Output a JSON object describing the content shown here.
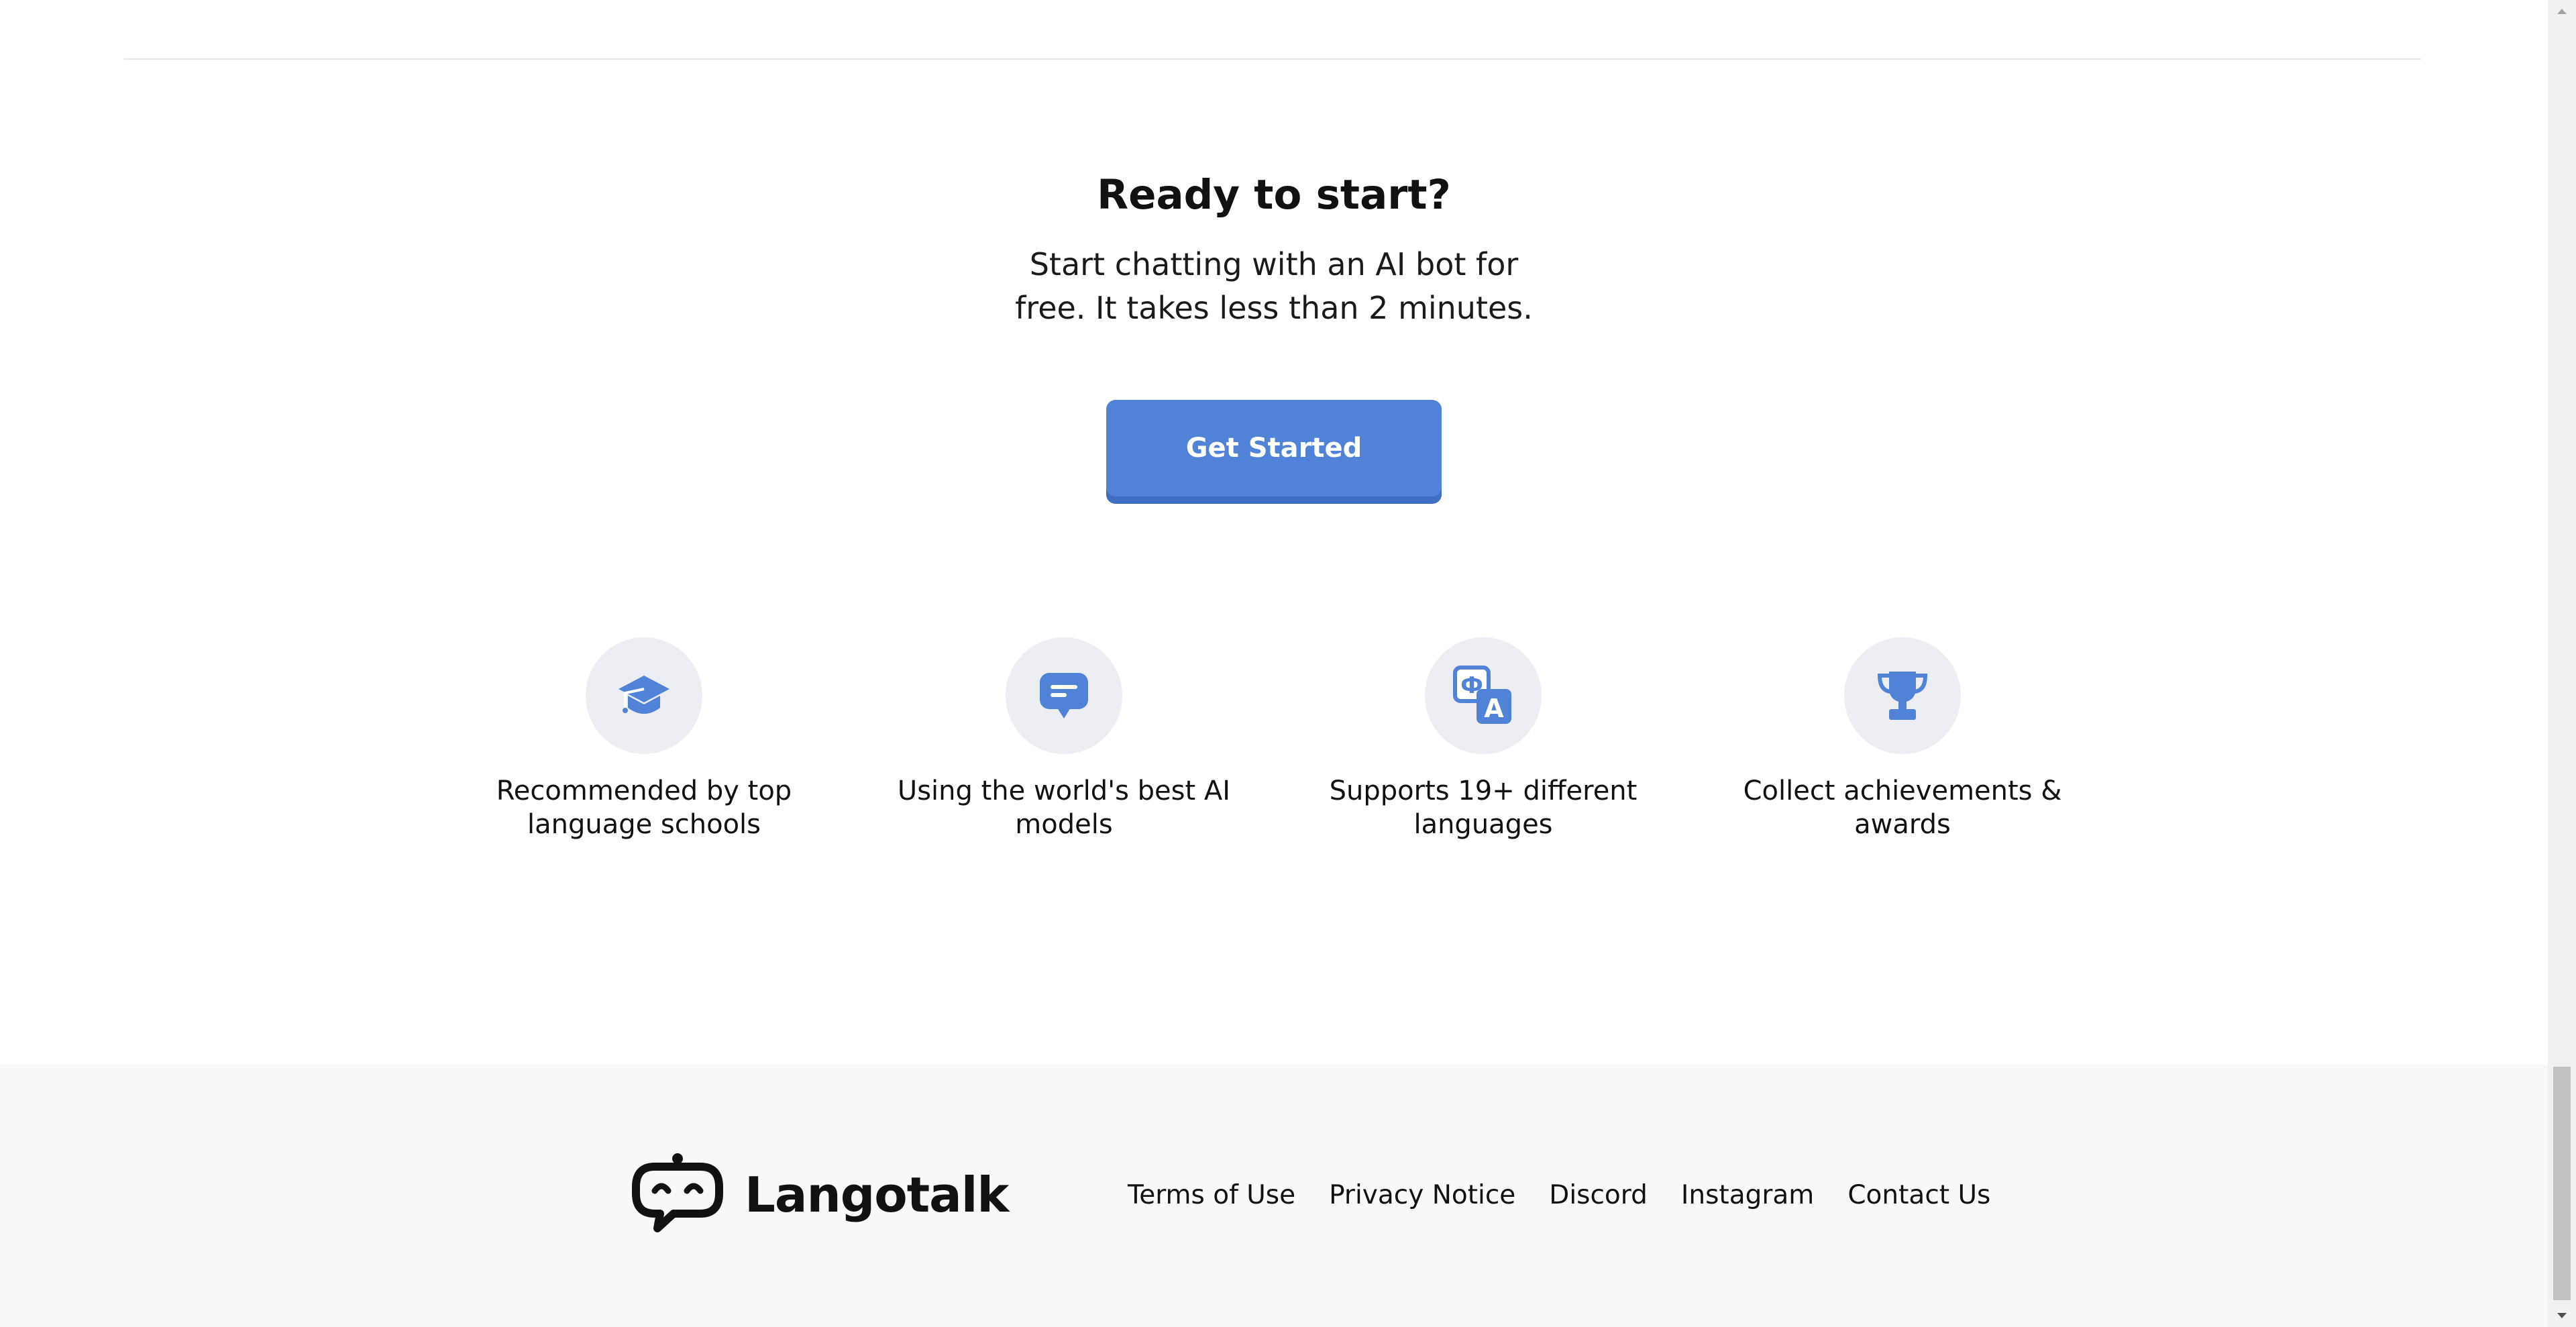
{
  "cta": {
    "title": "Ready to start?",
    "subtitle": "Start chatting with an AI bot for free. It takes less than 2 minutes.",
    "button_label": "Get Started"
  },
  "features": [
    {
      "icon": "graduation-cap-icon",
      "label": "Recommended by top language schools"
    },
    {
      "icon": "chat-bubble-icon",
      "label": "Using the world's best AI models"
    },
    {
      "icon": "translate-icon",
      "label": "Supports 19+ different languages"
    },
    {
      "icon": "trophy-icon",
      "label": "Collect achievements & awards"
    }
  ],
  "footer": {
    "brand": "Langotalk",
    "links": [
      "Terms of Use",
      "Privacy Notice",
      "Discord",
      "Instagram",
      "Contact Us"
    ]
  },
  "colors": {
    "accent": "#5083d8",
    "accent_dark": "#3f6ec2",
    "icon_circle": "#eceef3",
    "footer_bg": "#f7f8fa"
  }
}
